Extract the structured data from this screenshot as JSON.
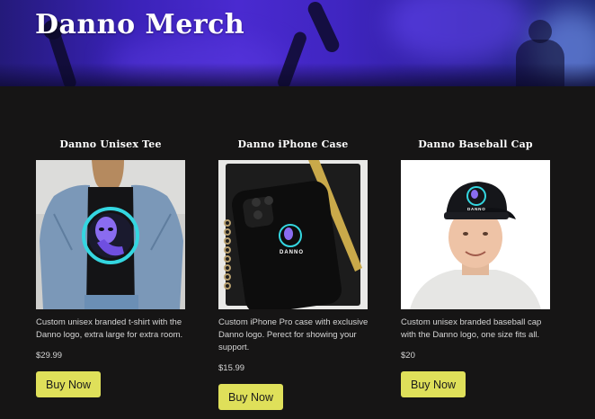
{
  "page": {
    "title": "Danno Merch"
  },
  "colors": {
    "background": "#161515",
    "button": "#dfe05a",
    "hero_purple": "#4a2ad0"
  },
  "products": [
    {
      "title": "Danno Unisex Tee",
      "image_icon": "tshirt-photo",
      "description": "Custom unisex branded t-shirt with the Danno logo, extra large for extra room.",
      "price": "$29.99",
      "button_label": "Buy Now"
    },
    {
      "title": "Danno iPhone Case",
      "image_icon": "phone-case-photo",
      "description": "Custom iPhone Pro case with exclusive Danno logo. Perect for showing your support.",
      "price": "$15.99",
      "button_label": "Buy Now",
      "logo_text": "DANNO"
    },
    {
      "title": "Danno Baseball Cap",
      "image_icon": "cap-photo",
      "description": "Custom unisex branded baseball cap with the Danno logo, one size fits all.",
      "price": "$20",
      "button_label": "Buy Now",
      "logo_text": "DANNO"
    }
  ]
}
